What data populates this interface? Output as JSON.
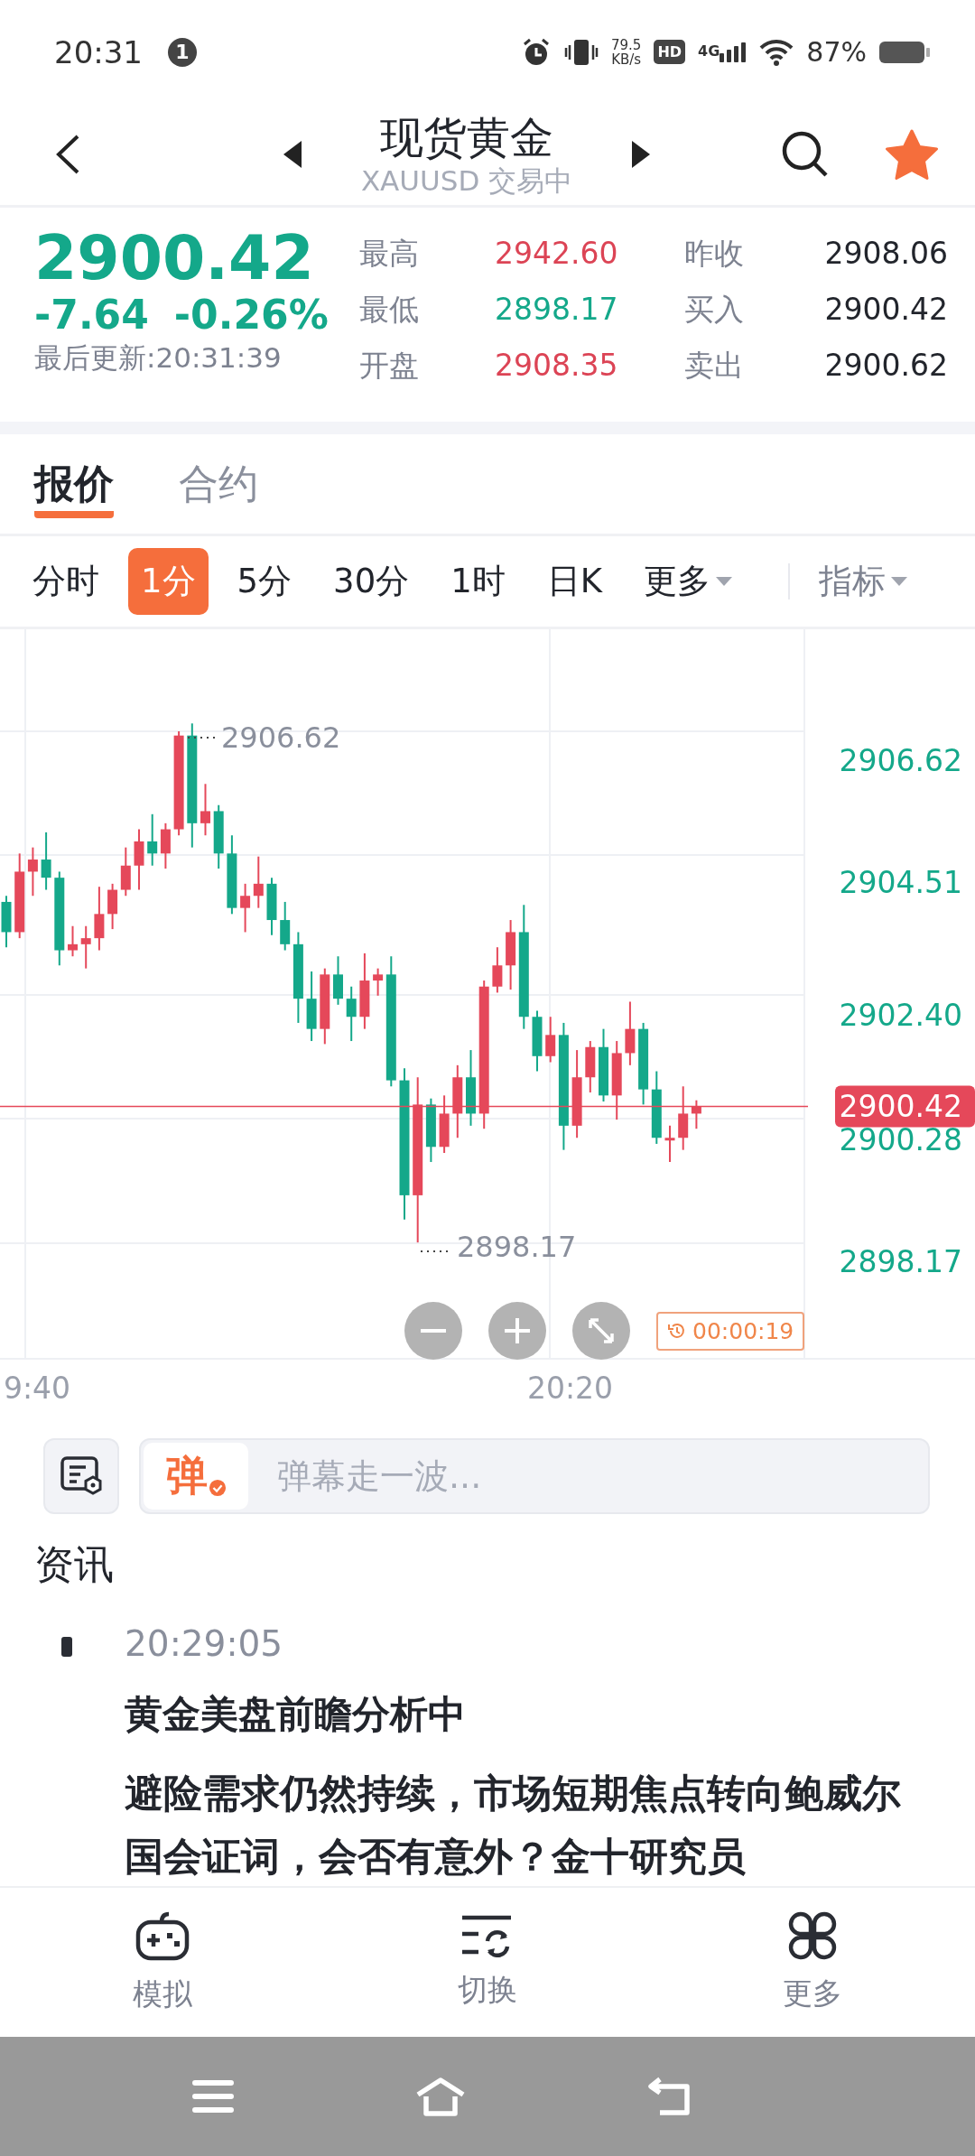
{
  "status_bar": {
    "time": "20:31",
    "notification_count": "1",
    "net_speed": "79.5",
    "net_unit": "KB/s",
    "hd": "HD",
    "network": "4G",
    "battery": "87%"
  },
  "header": {
    "title": "现货黄金",
    "subtitle": "XAUUSD 交易中",
    "favorite": true
  },
  "quote": {
    "price": "2900.42",
    "change": "-7.64",
    "change_pct": "-0.26%",
    "updated": "最后更新:20:31:39",
    "color": "#14a88a",
    "stats": [
      {
        "label": "最高",
        "value": "2942.60",
        "color": "#dc4455"
      },
      {
        "label": "昨收",
        "value": "2908.06",
        "color": "#22252c"
      },
      {
        "label": "最低",
        "value": "2898.17",
        "color": "#14a88a"
      },
      {
        "label": "买入",
        "value": "2900.42",
        "color": "#22252c"
      },
      {
        "label": "开盘",
        "value": "2908.35",
        "color": "#dc4455"
      },
      {
        "label": "卖出",
        "value": "2900.62",
        "color": "#22252c"
      }
    ]
  },
  "tabs": [
    {
      "label": "报价",
      "selected": true
    },
    {
      "label": "合约",
      "selected": false
    }
  ],
  "periods": [
    {
      "label": "分时",
      "selected": false,
      "menu": false
    },
    {
      "label": "1分",
      "selected": true,
      "menu": false
    },
    {
      "label": "5分",
      "selected": false,
      "menu": false
    },
    {
      "label": "30分",
      "selected": false,
      "menu": false
    },
    {
      "label": "1时",
      "selected": false,
      "menu": false
    },
    {
      "label": "日K",
      "selected": false,
      "menu": false
    },
    {
      "label": "更多",
      "selected": false,
      "menu": true
    }
  ],
  "indicator": {
    "label": "指标"
  },
  "chart": {
    "y_labels": [
      "2906.62",
      "2904.51",
      "2902.40",
      "2900.28",
      "2898.17"
    ],
    "high_label": "2906.62",
    "low_label": "2898.17",
    "last_price": "2900.42",
    "x_labels": [
      "9:40",
      "20:20"
    ],
    "timer": "00:00:19"
  },
  "barrage": {
    "badge": "弹",
    "placeholder": "弹幕走一波..."
  },
  "news": {
    "title": "资讯",
    "items": [
      {
        "time": "20:29:05",
        "headline": "黄金美盘前瞻分析中",
        "body": "避险需求仍然持续，市场短期焦点转向鲍威尔国会证词，会否有意外？金十研究员"
      }
    ]
  },
  "bottom_nav": [
    {
      "label": "模拟"
    },
    {
      "label": "切换"
    },
    {
      "label": "更多"
    }
  ]
}
